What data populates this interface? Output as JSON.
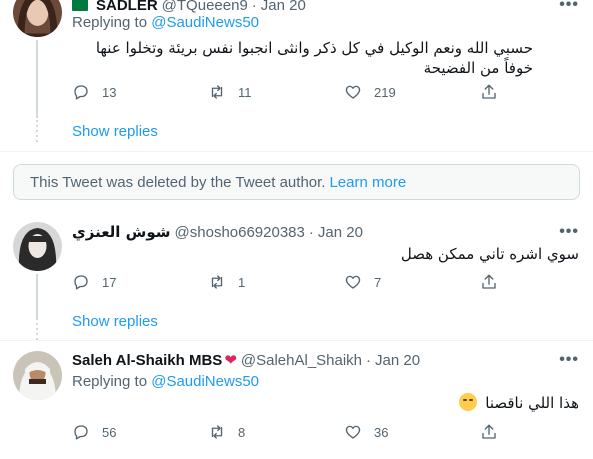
{
  "tweets": [
    {
      "name": "SADLER",
      "handle": "@TQueeen9",
      "date": "Jan 20",
      "replying_label": "Replying to",
      "replying_to": "@SaudiNews50",
      "text": "حسبي الله ونعم الوكيل في كل ذكر وانثى انجبوا نفس بريئة وتخلوا عنها خوفاً من الفضيحة",
      "replies": "13",
      "retweets": "11",
      "likes": "219",
      "show_replies": "Show replies"
    },
    {
      "name": "شوش العنزي",
      "handle": "@shosho66920383",
      "date": "Jan 20",
      "text": "سوي اشره تاني ممكن هصل",
      "replies": "17",
      "retweets": "1",
      "likes": "7",
      "show_replies": "Show replies"
    },
    {
      "name": "Saleh Al-Shaikh MBS",
      "name_emoji": "❤",
      "handle": "@SalehAl_Shaikh",
      "date": "Jan 20",
      "replying_label": "Replying to",
      "replying_to": "@SaudiNews50",
      "text": "هذا اللي ناقصنا",
      "replies": "56",
      "retweets": "8",
      "likes": "36"
    }
  ],
  "deleted_notice": {
    "text": "This Tweet was deleted by the Tweet author.",
    "link": "Learn more"
  },
  "separator": "·",
  "more_glyph": "•••",
  "colors": {
    "accent": "#1d9bf0",
    "muted": "#536471",
    "heart": "#e0245e"
  }
}
